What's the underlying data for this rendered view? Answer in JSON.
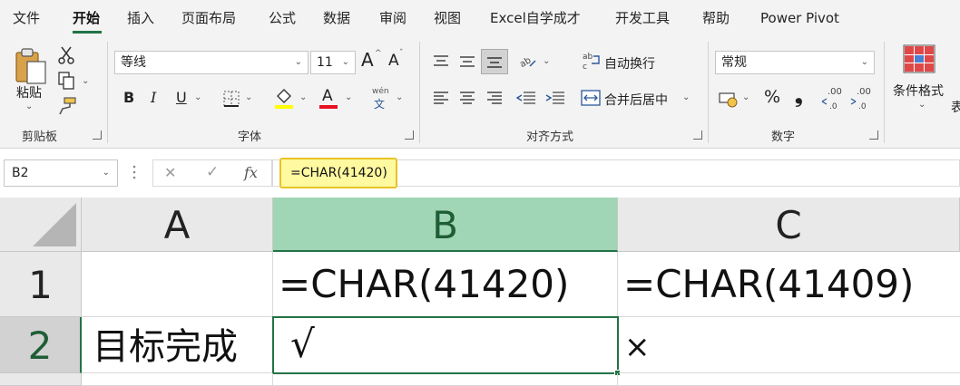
{
  "menu": {
    "tabs": [
      "文件",
      "开始",
      "插入",
      "页面布局",
      "公式",
      "数据",
      "审阅",
      "视图",
      "Excel自学成才",
      "开发工具",
      "帮助",
      "Power Pivot"
    ],
    "active": "开始"
  },
  "ribbon": {
    "clipboard": {
      "paste_label": "粘贴",
      "group_label": "剪贴板"
    },
    "font": {
      "font_name": "等线",
      "font_size": "11",
      "group_label": "字体",
      "bold": "B",
      "italic": "I",
      "underline": "U",
      "grow": "A",
      "shrink": "A",
      "phonetic_top": "wén",
      "phonetic_bottom": "文",
      "font_color_letter": "A"
    },
    "alignment": {
      "wrap_text": "自动换行",
      "merge_center": "合并后居中",
      "group_label": "对齐方式"
    },
    "number": {
      "format": "常规",
      "percent": "%",
      "comma": "❟",
      "group_label": "数字",
      "inc_decimal": ".00",
      "dec_decimal": ".00"
    },
    "styles": {
      "conditional_format": "条件格式",
      "partial_label": "表"
    }
  },
  "formula_bar": {
    "name_box": "B2",
    "fx": "fx",
    "formula": "=CHAR(41420)"
  },
  "sheet": {
    "columns": [
      "A",
      "B",
      "C"
    ],
    "rows": [
      "1",
      "2"
    ],
    "selected_column": "B",
    "selected_row": "2",
    "cells": {
      "A1": "",
      "B1": "=CHAR(41420)",
      "C1": "=CHAR(41409)",
      "A2": "目标完成",
      "B2": "√",
      "C2": "×"
    }
  },
  "colors": {
    "accent": "#217346",
    "selected_header": "#a0d5b5",
    "highlight_fill": "#fff9a0",
    "highlight_border": "#e8c327",
    "font_color_bar": "#e81123",
    "highlight_color_bar": "#ffff00"
  }
}
